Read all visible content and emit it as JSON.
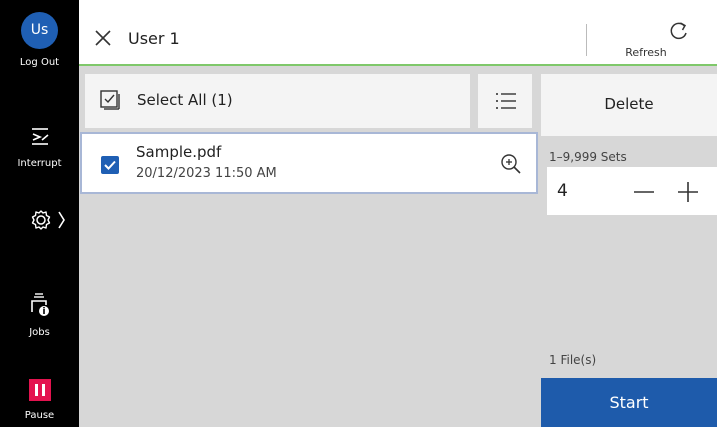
{
  "sidebar": {
    "avatar_text": "Us",
    "logout_label": "Log Out",
    "interrupt_label": "Interrupt",
    "jobs_label": "Jobs",
    "pause_label": "Pause"
  },
  "header": {
    "title": "User 1",
    "refresh_label": "Refresh"
  },
  "list": {
    "select_all_label": "Select All (1)",
    "files": [
      {
        "name": "Sample.pdf",
        "date": "20/12/2023 11:50 AM",
        "checked": true
      }
    ]
  },
  "panel": {
    "delete_label": "Delete",
    "sets_range_label": "1–9,999 Sets",
    "quantity": "4",
    "files_count_label": "1 File(s)",
    "start_label": "Start"
  },
  "colors": {
    "sidebar_bg": "#000000",
    "avatar": "#1f5fb4",
    "pause": "#e4134f",
    "start": "#1e5bab",
    "header_accent": "#7fc86a",
    "panel_bg": "#d7d7d7"
  }
}
